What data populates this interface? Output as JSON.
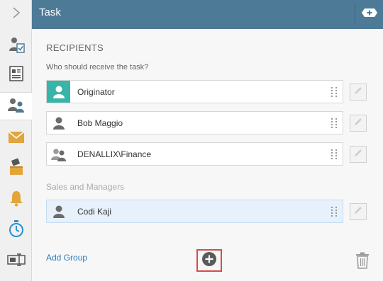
{
  "header": {
    "title": "Task"
  },
  "sidebar": {
    "items": [
      {
        "icon": "chevron-right-icon"
      },
      {
        "icon": "user-clipboard-icon"
      },
      {
        "icon": "form-icon"
      },
      {
        "icon": "recipients-icon",
        "active": true
      },
      {
        "icon": "envelope-icon"
      },
      {
        "icon": "ballot-box-icon"
      },
      {
        "icon": "bell-icon"
      },
      {
        "icon": "stopwatch-icon"
      },
      {
        "icon": "text-field-icon"
      }
    ]
  },
  "recipients": {
    "section_title": "RECIPIENTS",
    "prompt": "Who should receive the task?",
    "rows": [
      {
        "label": "Originator",
        "icon": "user-icon-teal"
      },
      {
        "label": "Bob Maggio",
        "icon": "user-icon"
      },
      {
        "label": "DENALLIX\\Finance",
        "icon": "group-icon"
      }
    ]
  },
  "group": {
    "label": "Sales and Managers",
    "rows": [
      {
        "label": "Codi Kaji",
        "icon": "user-icon",
        "selected": true
      }
    ]
  },
  "footer": {
    "add_group": "Add Group"
  },
  "colors": {
    "header": "#4d7a96",
    "accent_teal": "#39b4a8",
    "link": "#2b7bbf",
    "highlight_border": "#d84b47",
    "selected_row": "#e6f1fb"
  }
}
